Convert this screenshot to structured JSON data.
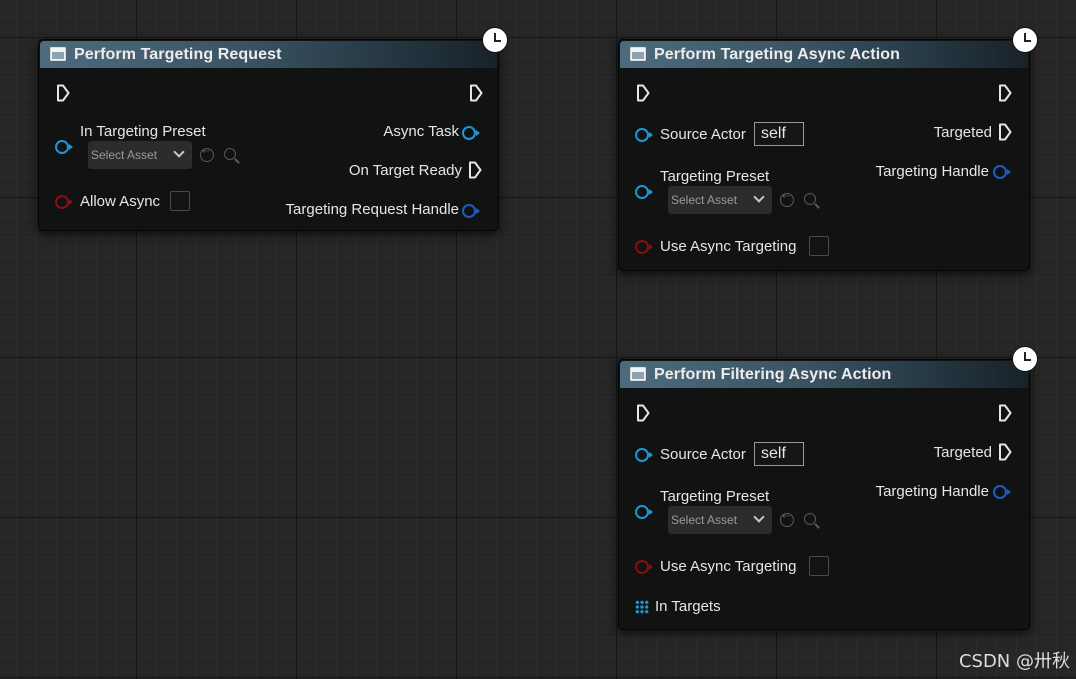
{
  "nodes": {
    "perform_targeting_request": {
      "title": "Perform Targeting Request",
      "in_targeting_preset": "In Targeting Preset",
      "select_asset": "Select Asset",
      "allow_async": "Allow Async",
      "async_task": "Async Task",
      "on_target_ready": "On Target Ready",
      "targeting_request_handle": "Targeting Request Handle"
    },
    "perform_targeting_async_action": {
      "title": "Perform Targeting Async Action",
      "source_actor": "Source Actor",
      "source_actor_value": "self",
      "targeting_preset": "Targeting Preset",
      "select_asset": "Select Asset",
      "use_async_targeting": "Use Async Targeting",
      "targeted": "Targeted",
      "targeting_handle": "Targeting Handle"
    },
    "perform_filtering_async_action": {
      "title": "Perform Filtering Async Action",
      "source_actor": "Source Actor",
      "source_actor_value": "self",
      "targeting_preset": "Targeting Preset",
      "select_asset": "Select Asset",
      "use_async_targeting": "Use Async Targeting",
      "in_targets": "In Targets",
      "targeted": "Targeted",
      "targeting_handle": "Targeting Handle"
    }
  },
  "watermark": "CSDN @卅秋",
  "colors": {
    "object_pin": "#1f97d6",
    "struct_pin": "#1d5ec0",
    "bool_pin": "#8a1010",
    "background": "#262626"
  }
}
